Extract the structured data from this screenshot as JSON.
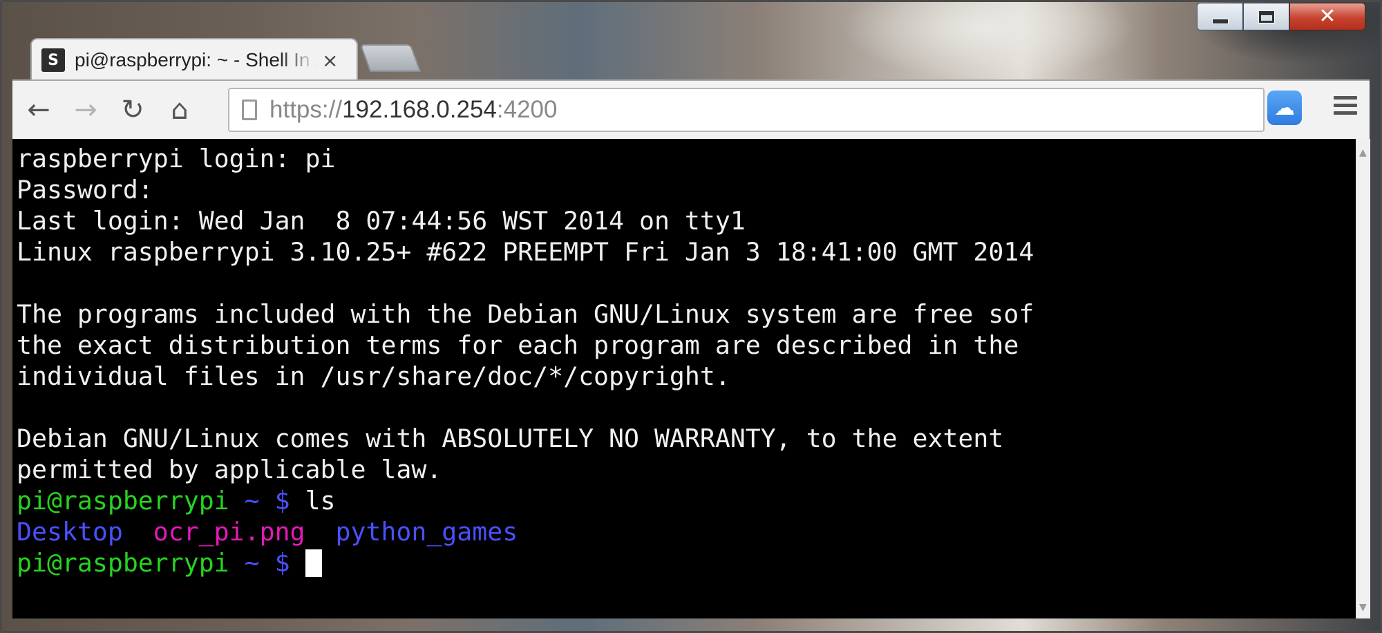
{
  "window": {
    "controls": [
      "minimize",
      "maximize",
      "close"
    ],
    "close_glyph": "✕"
  },
  "tab": {
    "favicon_letter": "S",
    "title": "pi@raspberrypi: ~ - Shell In A Box",
    "close_glyph": "×"
  },
  "toolbar": {
    "back_glyph": "←",
    "forward_glyph": "→",
    "reload_glyph": "↻",
    "home_glyph": "⌂"
  },
  "address": {
    "scheme": "https://",
    "host": "192.168.0.254",
    "port": ":4200"
  },
  "terminal": {
    "lines": [
      "raspberrypi login: pi",
      "Password:",
      "Last login: Wed Jan  8 07:44:56 WST 2014 on tty1",
      "Linux raspberrypi 3.10.25+ #622 PREEMPT Fri Jan 3 18:41:00 GMT 2014",
      "",
      "The programs included with the Debian GNU/Linux system are free sof",
      "the exact distribution terms for each program are described in the",
      "individual files in /usr/share/doc/*/copyright.",
      "",
      "Debian GNU/Linux comes with ABSOLUTELY NO WARRANTY, to the extent",
      "permitted by applicable law."
    ],
    "prompt_user": "pi@raspberrypi",
    "prompt_path": "~ $",
    "command": "ls",
    "ls_output": [
      "Desktop",
      "ocr_pi.png",
      "python_games"
    ],
    "colors": {
      "prompt": "#27d31f",
      "path": "#4a50ff",
      "directory": "#4a50ff",
      "image_file": "#e41ab8"
    }
  }
}
